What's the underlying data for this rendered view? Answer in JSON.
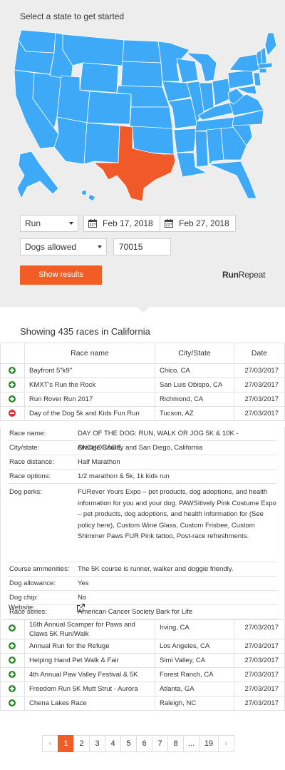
{
  "header": {
    "prompt": "Select a state to get started"
  },
  "map": {
    "default_color": "#3da9f7",
    "selected_color": "#f05a28",
    "selected_state": "Texas"
  },
  "filters": {
    "activity": "Run",
    "date_from": "Feb 17, 2018",
    "date_to": "Feb 27, 2018",
    "dogs": "Dogs allowed",
    "zip": "70015",
    "submit_label": "Show results"
  },
  "brand": {
    "part1": "Run",
    "part2": "Repeat"
  },
  "results": {
    "summary": "Showing 435 races in California",
    "headers": [
      "Race name",
      "City/State",
      "Date"
    ],
    "rows_before": [
      {
        "name": "Bayfront 5\"k9\"",
        "city": "Chico, CA",
        "date": "27/03/2017",
        "state": "plus"
      },
      {
        "name": "KMXT's Run the Rock",
        "city": "San Luis Obispo, CA",
        "date": "27/03/2017",
        "state": "plus"
      },
      {
        "name": "Run Rover Run 2017",
        "city": "Richmond, CA",
        "date": "27/03/2017",
        "state": "plus"
      },
      {
        "name": "Day of the Dog 5k and Kids Fun Run",
        "city": "Tucson, AZ",
        "date": "27/03/2017",
        "state": "minus"
      }
    ],
    "detail": [
      {
        "key": "Race name:",
        "value": "DAY OF THE DOG: RUN, WALK OR JOG 5K & 10K - ANCHORAGE"
      },
      {
        "key": "City/state:",
        "value": "Orange County and San Diego, California"
      },
      {
        "key": "Race distance:",
        "value": "Half Marathon"
      },
      {
        "key": "Race options:",
        "value": "1/2 marathon & 5k, 1k kids run"
      },
      {
        "key": "Dog perks:",
        "value": "FURever Yours Expo – pet products, dog adoptions, and health information for you and your dog. PAWSitively Pink Costume Expo – pet products, dog adoptions, and health information for (See policy here), Custom Wine Glass, Custom Frisbee, Custom Shimmer Paws FUR Pink tattoo, Post-race refreshments."
      },
      {
        "key": "Course ammenities:",
        "value": "The 5K course is runner, walker and doggie friendly."
      },
      {
        "key": "Dog allowance:",
        "value": "Yes"
      },
      {
        "key": "Dog chip:",
        "value": "No"
      },
      {
        "key": "Race series:",
        "value": "American Cancer Society Bark for Life"
      },
      {
        "key": "Website:",
        "value": ""
      }
    ],
    "rows_after": [
      {
        "name": "16th Annual Scamper for Paws and Claws 5K Run/Walk",
        "city": "Irving, CA",
        "date": "27/03/2017",
        "state": "plus"
      },
      {
        "name": "Annual Run for the Refuge",
        "city": "Los Angeles, CA",
        "date": "27/03/2017",
        "state": "plus"
      },
      {
        "name": "Helping Hand Pet Walk & Fair",
        "city": "Simi Valley, CA",
        "date": "27/03/2017",
        "state": "plus"
      },
      {
        "name": "4th Annual Paw Valley Festival & 5K",
        "city": "Forest Ranch, CA",
        "date": "27/03/2017",
        "state": "plus"
      },
      {
        "name": "Freedom Run 5K  Mutt Strut - Aurora",
        "city": "Atlanta, GA",
        "date": "27/03/2017",
        "state": "plus"
      },
      {
        "name": "Chena Lakes Race",
        "city": "Raleigh, NC",
        "date": "27/03/2017",
        "state": "plus"
      }
    ]
  },
  "pagination": {
    "prev": "‹",
    "pages": [
      "1",
      "2",
      "3",
      "4",
      "5",
      "6",
      "7",
      "8",
      "...",
      "19"
    ],
    "current": "1",
    "next": "›"
  }
}
